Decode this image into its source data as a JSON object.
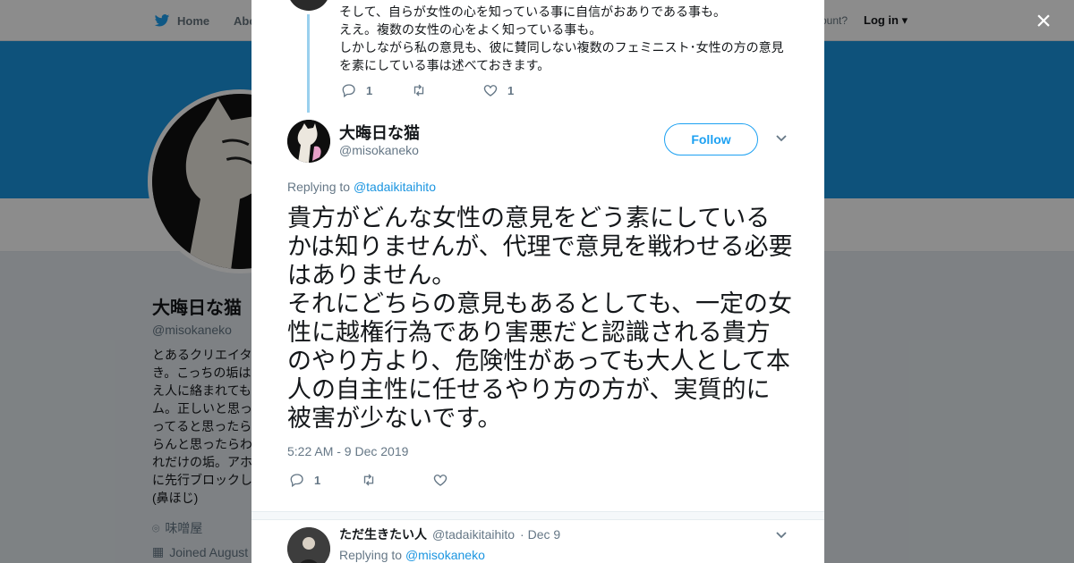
{
  "nav": {
    "home": "Home",
    "about": "Abo",
    "account": "ccount?",
    "login": "Log in"
  },
  "profile": {
    "name": "大晦日な猫",
    "handle": "@misokaneko",
    "bio": "とあるクリエイタ\nき。こっちの垢は\nえ人に絡まれても\nム。正しいと思っ\nってると思ったら\nらんと思ったらわ\nれだけの垢。アホ\nに先行ブロックし\n(鼻ほじ)",
    "location": "味噌屋",
    "joined": "Joined August"
  },
  "modal": {
    "previous_tweet": {
      "lines": [
        "そして、自らが女性の心を知っている事に自信がおありである事も。",
        "ええ。複数の女性の心をよく知っている事も。",
        "しかしながら私の意見も、彼に賛同しない複数のフェミニスト･女性の方の意見を素にしている事は述べておきます。"
      ],
      "reply_count": "1",
      "like_count": "1"
    },
    "main_tweet": {
      "name": "大晦日な猫",
      "handle": "@misokaneko",
      "follow_label": "Follow",
      "replying_prefix": "Replying to",
      "replying_to": "@tadaikitaihito",
      "text": "貴方がどんな女性の意見をどう素にしているかは知りませんが、代理で意見を戦わせる必要はありません。\nそれにどちらの意見もあるとしても、一定の女性に越権行為であり害悪だと認識される貴方のやり方より、危険性があっても大人として本人の自主性に任せるやり方の方が、実質的に被害が少ないです。",
      "timestamp": "5:22 AM - 9 Dec 2019",
      "reply_count": "1"
    },
    "reply_tweet": {
      "name": "ただ生きたい人",
      "handle": "@tadaikitaihito",
      "date": "· Dec 9",
      "replying_prefix": "Replying to",
      "replying_to": "@misokaneko"
    },
    "close": "×"
  },
  "colors": {
    "accent": "#1da1f2",
    "banner": "#1b95e0",
    "thread": "#9ad0ee"
  }
}
